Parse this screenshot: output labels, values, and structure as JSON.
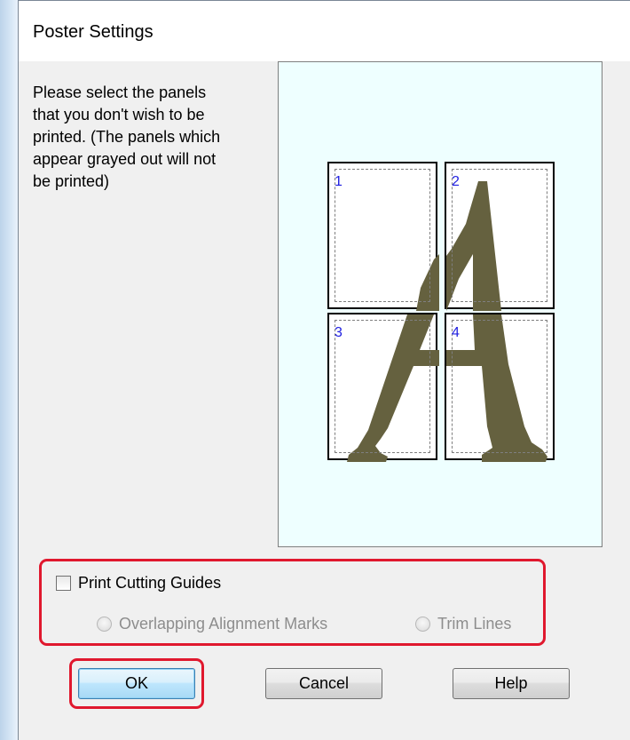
{
  "dialog": {
    "title": "Poster Settings",
    "instructions": "Please select the panels\nthat you don't wish to be\nprinted. (The panels which\nappear grayed out will not\nbe printed)"
  },
  "preview": {
    "panels": [
      "1",
      "2",
      "3",
      "4"
    ],
    "glyph_color": "#65613f",
    "background_color": "#eeffff"
  },
  "options": {
    "print_cutting_guides_label": "Print Cutting Guides",
    "print_cutting_guides_checked": false,
    "overlapping_alignment_marks_label": "Overlapping Alignment Marks",
    "trim_lines_label": "Trim Lines"
  },
  "buttons": {
    "ok_label": "OK",
    "cancel_label": "Cancel",
    "help_label": "Help"
  },
  "highlight_color": "#e0182e"
}
